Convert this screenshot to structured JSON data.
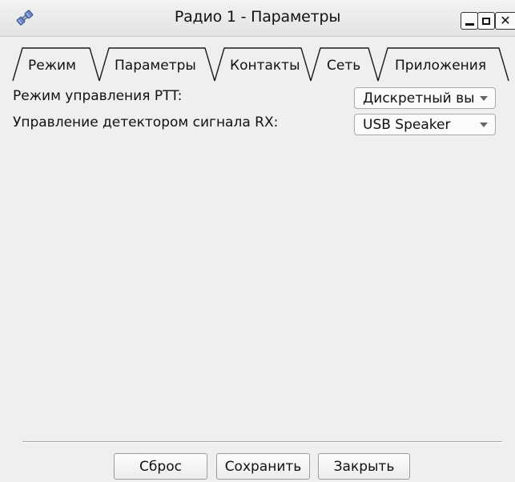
{
  "window": {
    "title": "Радио 1 - Параметры",
    "icon": "satellite-icon",
    "controls": {
      "minimize_icon": "minimize-icon",
      "maximize_icon": "maximize-icon",
      "close_icon": "close-icon",
      "close_glyph": "✕"
    }
  },
  "tabs": [
    {
      "label": "Режим",
      "active": false
    },
    {
      "label": "Параметры",
      "active": true
    },
    {
      "label": "Контакты",
      "active": false
    },
    {
      "label": "Сеть",
      "active": false
    },
    {
      "label": "Приложения",
      "active": false
    }
  ],
  "settings": {
    "ptt_mode": {
      "label": "Режим управления PTT:",
      "value": "Дискретный вы"
    },
    "rx_detector": {
      "label": "Управление детектором сигнала RX:",
      "value": "USB Speaker"
    }
  },
  "buttons": {
    "reset": "Сброс",
    "save": "Сохранить",
    "close": "Закрыть"
  },
  "colors": {
    "background": "#efefef",
    "border": "#2a2a2a"
  }
}
